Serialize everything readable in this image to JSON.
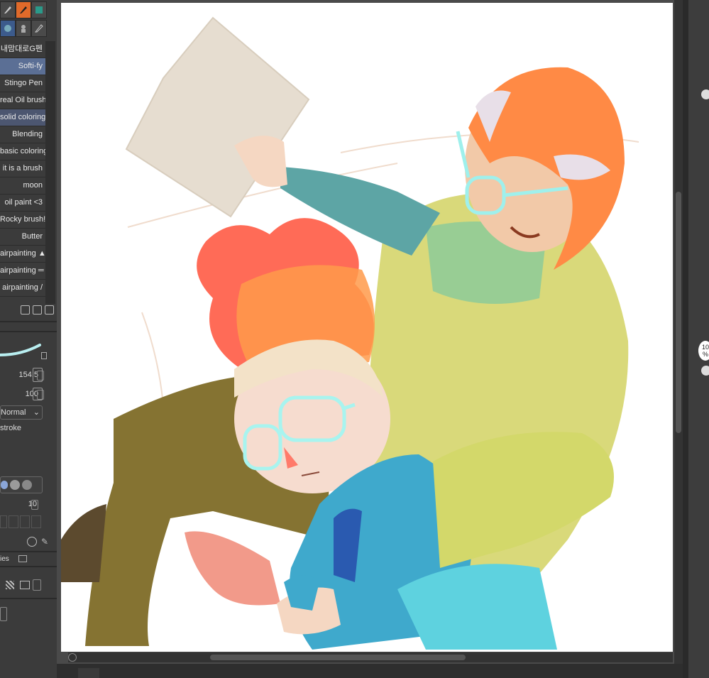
{
  "brush_list": {
    "items": [
      "내맘대로G펜",
      "Softi-fy",
      "Stingo Pen",
      "real Oil brush",
      "solid coloring",
      "Blending",
      "basic coloring",
      "it is a brush",
      "moon",
      "oil paint <3",
      "Rocky brush!",
      "Butter",
      "airpainting ▲",
      "airpainting ═",
      "airpainting /"
    ]
  },
  "tool_property": {
    "size_value": "154.5",
    "opacity_value": "100",
    "blend_mode": "Normal",
    "stroke_label": "stroke",
    "density_value": "10"
  },
  "tabs": {
    "properties_label": "ies"
  },
  "zoom": {
    "value": "10",
    "unit": "%"
  },
  "colors": {
    "accent": "#e06a2a",
    "selected": "#5b6f95",
    "panel": "#3b3b3b"
  }
}
